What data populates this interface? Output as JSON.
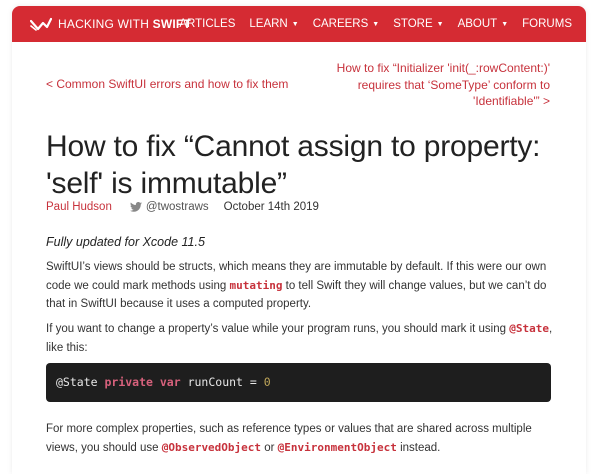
{
  "nav": {
    "logo_light": "HACKING WITH ",
    "logo_bold": "SWIFT",
    "items": [
      {
        "label": "ARTICLES",
        "caret": false
      },
      {
        "label": "LEARN",
        "caret": true
      },
      {
        "label": "CAREERS",
        "caret": true
      },
      {
        "label": "STORE",
        "caret": true
      },
      {
        "label": "ABOUT",
        "caret": true
      },
      {
        "label": "FORUMS",
        "caret": false
      }
    ],
    "caret_glyph": "▼"
  },
  "prev_link": "< Common SwiftUI errors and how to fix them",
  "next_link": "How to fix “Initializer 'init(_:rowContent:)' requires that ‘SomeType’ conform to 'Identifiable'” >",
  "article": {
    "title": "How to fix “Cannot assign to property: 'self' is immutable”",
    "author": "Paul Hudson",
    "twitter_handle": "@twostraws",
    "date": "October 14th 2019",
    "updated": "Fully updated for Xcode 11.5",
    "p1": {
      "a": "SwiftUI’s views should be structs, which means they are immutable by default. If this were our own code we could mark methods using ",
      "kw": "mutating",
      "b": " to tell Swift they will change values, but we can’t do that in SwiftUI because it uses a computed property."
    },
    "p2": {
      "a": "If you want to change a property’s value while your program runs, you should mark it using ",
      "kw": "@State",
      "b": ", like this:"
    },
    "code": {
      "attr": "@State ",
      "kw1": "private",
      "sp1": " ",
      "kw2": "var",
      "rest": " runCount = ",
      "num": "0"
    },
    "p3": {
      "a": "For more complex properties, such as reference types or values that are shared across multiple views, you should use ",
      "kw1": "@ObservedObject",
      "mid": " or ",
      "kw2": "@EnvironmentObject",
      "b": " instead."
    }
  },
  "colors": {
    "brand_red": "#d52b33",
    "link_red": "#c7323c",
    "code_bg": "#1e1e1e"
  }
}
